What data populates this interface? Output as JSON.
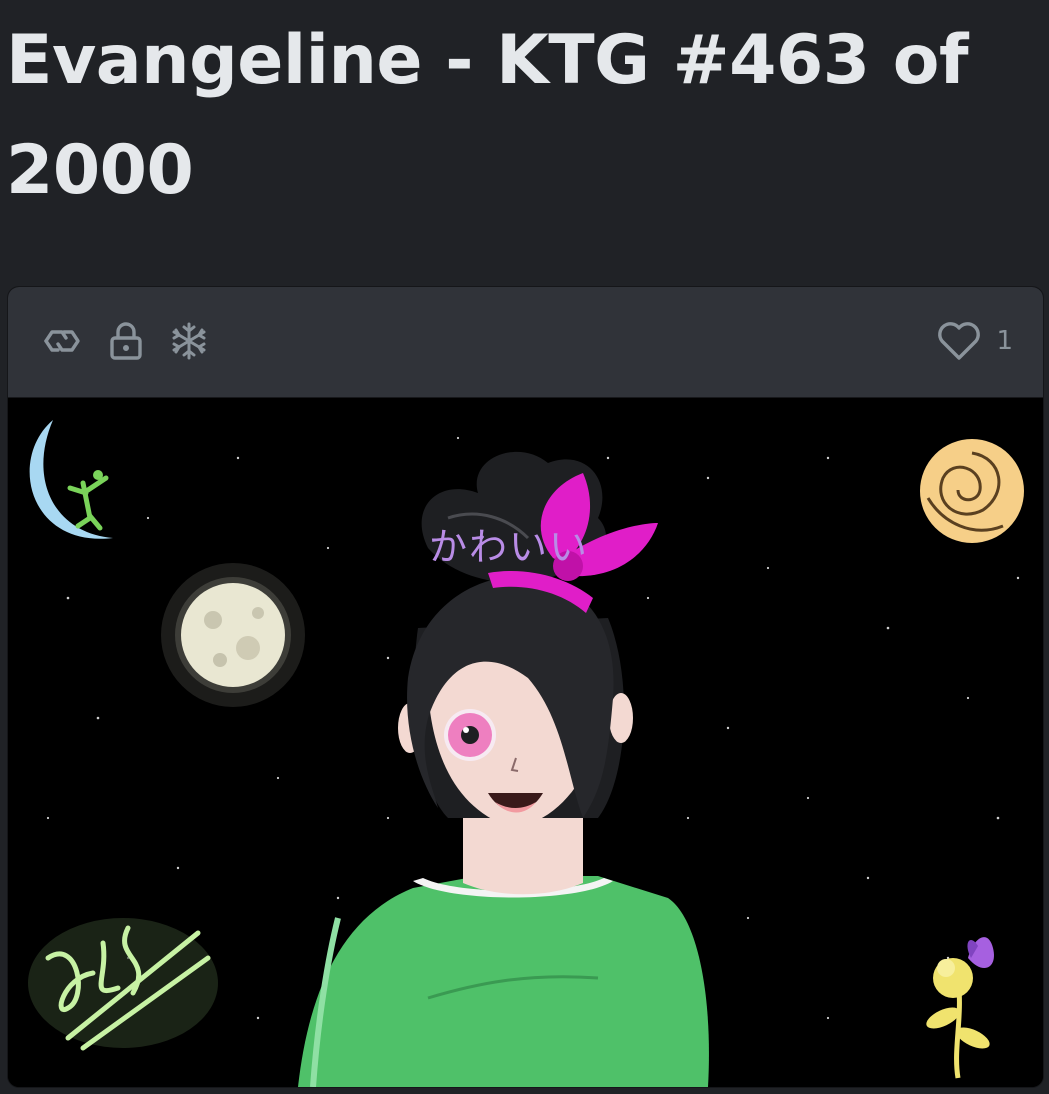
{
  "item": {
    "title": "Evangeline - KTG #463 of 2000"
  },
  "card": {
    "header_icons": [
      "polygon-chain-icon",
      "lock-icon",
      "freeze-icon"
    ],
    "favorites": {
      "icon": "heart-icon",
      "count": "1"
    }
  },
  "artwork": {
    "caption": "かわいい",
    "colors": {
      "background": "#000000",
      "hair": "#1e1f22",
      "ribbon": "#e01ec8",
      "shirt": "#4fc169",
      "skin": "#f3d9d2",
      "eye": "#ee7fc0",
      "moon_glow": "#e9e7d2",
      "crescent": "#a8d8f2",
      "rose": "#f6cf88",
      "signature_glow": "#c7f2a4",
      "flower": "#f0e36e",
      "butterfly": "#a660e0"
    }
  }
}
